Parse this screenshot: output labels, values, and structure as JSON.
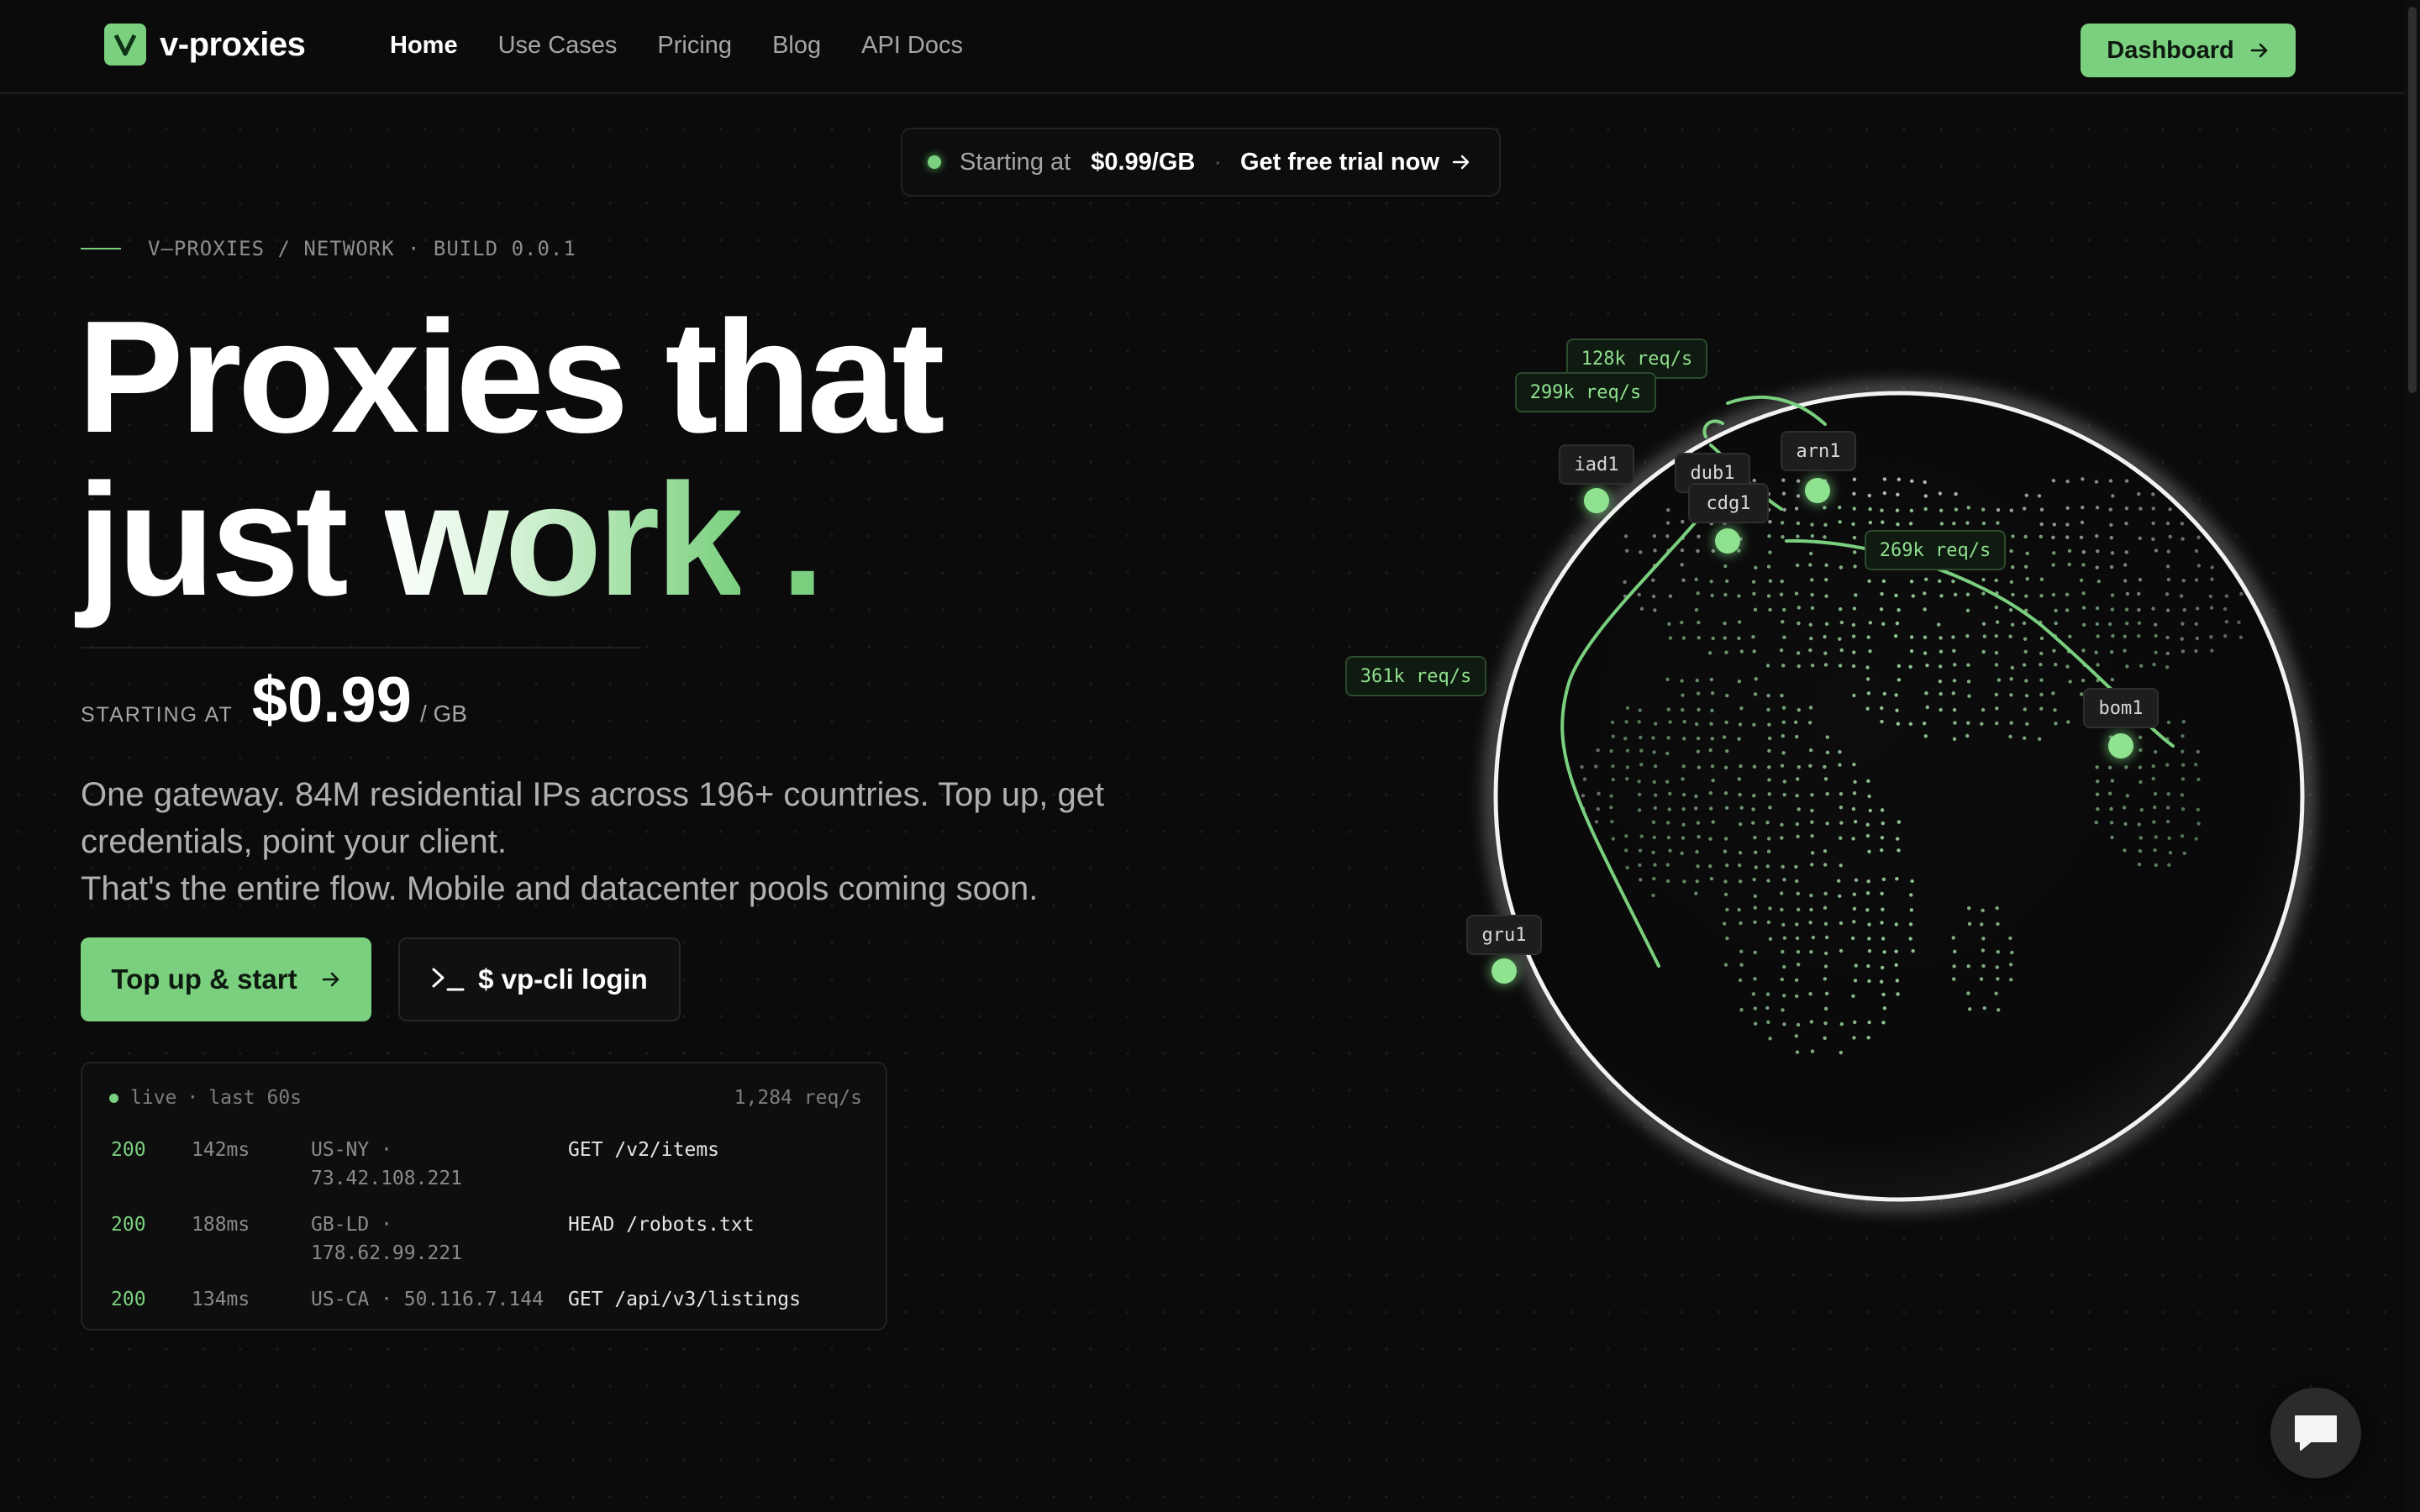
{
  "brand": {
    "name": "v-proxies",
    "logo_letter": "V",
    "accent": "#7ad07f"
  },
  "nav": {
    "items": [
      {
        "label": "Home",
        "active": true
      },
      {
        "label": "Use Cases"
      },
      {
        "label": "Pricing"
      },
      {
        "label": "Blog"
      },
      {
        "label": "API Docs"
      }
    ],
    "dashboard_label": "Dashboard"
  },
  "announcement": {
    "prefix": "Starting at",
    "price": "$0.99/GB",
    "separator": "·",
    "cta": "Get free trial now"
  },
  "breadcrumb": "V—PROXIES / NETWORK · BUILD 0.0.1",
  "hero": {
    "line1": "Proxies that",
    "line2_plain": "just",
    "line2_accent": "work",
    "line2_dot": "."
  },
  "pricing": {
    "label": "STARTING AT",
    "value": "$0.99",
    "unit": "/ GB"
  },
  "description": {
    "line1": "One gateway. 84M residential IPs across 196+ countries. Top up, get credentials, point your client.",
    "line2": "That's the entire flow. Mobile and datacenter pools coming soon."
  },
  "cta": {
    "primary": "Top up & start",
    "secondary": "$ vp-cli login"
  },
  "live_log": {
    "status": "live",
    "window": "last 60s",
    "rate": "1,284 req/s",
    "rows": [
      {
        "status": "200",
        "latency": "142ms",
        "origin": "US-NY · 73.42.108.221",
        "request": "GET /v2/items"
      },
      {
        "status": "200",
        "latency": "188ms",
        "origin": "GB-LD · 178.62.99.221",
        "request": "HEAD /robots.txt"
      },
      {
        "status": "200",
        "latency": "134ms",
        "origin": "US-CA · 50.116.7.144",
        "request": "GET /api/v3/listings"
      }
    ]
  },
  "globe": {
    "nodes": [
      "iad1",
      "dub1",
      "cdg1",
      "arn1",
      "bom1",
      "gru1"
    ],
    "rates": [
      "128k req/s",
      "299k req/s",
      "269k req/s",
      "361k req/s"
    ]
  },
  "icons": {
    "logo": "v-logo-icon",
    "arrow": "arrow-right-icon",
    "terminal": "terminal-icon",
    "chat": "chat-icon"
  }
}
